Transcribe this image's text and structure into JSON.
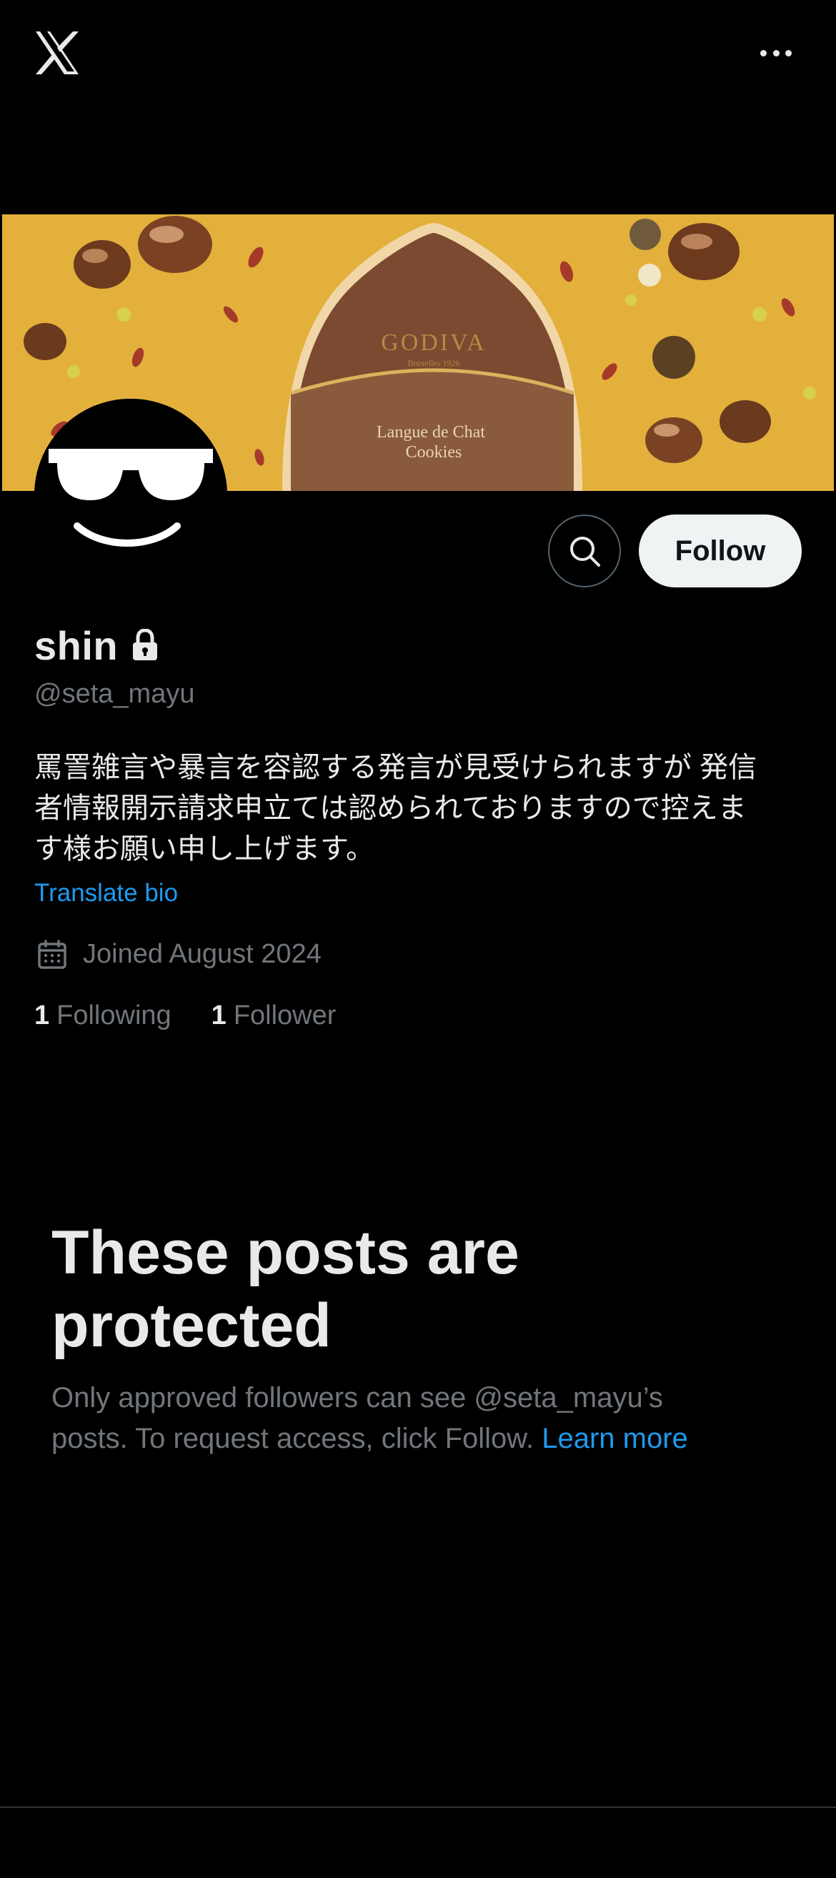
{
  "topbar": {
    "logo_icon": "x-logo-icon",
    "more_icon": "more-options-icon"
  },
  "banner": {
    "brand_text": "GODIVA",
    "brand_sub": "Bruxelles 1926",
    "product_line1": "Langue de Chat",
    "product_line2": "Cookies",
    "bg_color": "#e7b33d"
  },
  "actions": {
    "search_icon": "search-icon",
    "follow_label": "Follow"
  },
  "profile": {
    "display_name": "shin",
    "protected_icon": "lock-icon",
    "handle": "@seta_mayu",
    "bio_line1": "罵詈雑言や暴言を容認する発言が見受けられますが 発信",
    "bio_line2": "者情報開示請求申立ては認められておりますので控えま",
    "bio_line3": "す様お願い申し上げます。",
    "translate_label": "Translate bio",
    "joined_icon": "calendar-icon",
    "joined_text": "Joined August 2024",
    "following_count": "1",
    "following_label": "Following",
    "followers_count": "1",
    "followers_label": "Follower"
  },
  "protected": {
    "title_line1": "These posts are",
    "title_line2": "protected",
    "text_line1": "Only approved followers can see @seta_mayu’s",
    "text_line2": "posts. To request access, click Follow.",
    "learn_more_label": "Learn more"
  },
  "colors": {
    "background": "#000000",
    "text_primary": "#e7e9ea",
    "text_secondary": "#71767b",
    "accent": "#1d9bf0",
    "follow_button_bg": "#eff3f4"
  }
}
